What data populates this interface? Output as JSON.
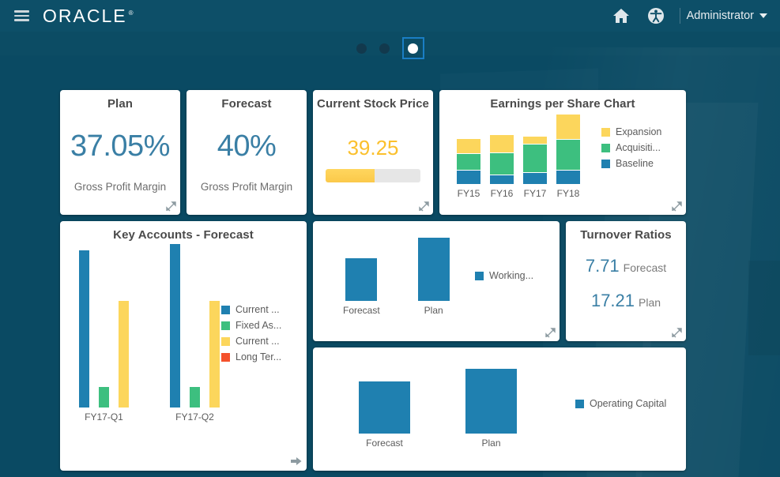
{
  "header": {
    "menu_icon": "hamburger-menu-icon",
    "brand": "ORACLE",
    "brand_tm": "®",
    "home_icon": "home-icon",
    "accessibility_icon": "accessibility-icon",
    "user_label": "Administrator",
    "caret_icon": "chevron-down-icon"
  },
  "pager": {
    "dots": [
      "page-1",
      "page-2",
      "page-3"
    ],
    "selected_index": 2
  },
  "tiles": {
    "plan_kpi": {
      "title": "Plan",
      "value": "37.05%",
      "subtitle": "Gross Profit Margin",
      "resize_icon": "resize-handle-icon"
    },
    "forecast_kpi": {
      "title": "Forecast",
      "value": "40%",
      "subtitle": "Gross Profit Margin",
      "resize_icon": "resize-handle-icon"
    },
    "stock": {
      "title": "Current Stock Price",
      "value": "39.25",
      "progress_percent": 52,
      "fill_color": "#fbc94a",
      "track_color": "#e6e6e6",
      "resize_icon": "resize-handle-icon"
    },
    "eps": {
      "title": "Earnings per Share Chart",
      "resize_icon": "resize-handle-icon"
    },
    "key_accounts": {
      "title": "Key Accounts - Forecast",
      "arrow_icon": "arrow-right-icon"
    },
    "working_capital": {
      "title": "",
      "resize_icon": "resize-handle-icon"
    },
    "turnover": {
      "title": "Turnover Ratios",
      "rows": [
        {
          "value": "7.71",
          "label": "Forecast"
        },
        {
          "value": "17.21",
          "label": "Plan"
        }
      ],
      "resize_icon": "resize-handle-icon"
    },
    "operating_capital": {
      "title": ""
    }
  },
  "chart_data": [
    {
      "id": "eps",
      "type": "bar",
      "stacked": true,
      "title": "Earnings per Share Chart",
      "categories": [
        "FY15",
        "FY16",
        "FY17",
        "FY18"
      ],
      "series": [
        {
          "name": "Baseline",
          "color": "#1f80b0",
          "values": [
            20,
            13,
            17,
            20
          ]
        },
        {
          "name": "Acquisiti...",
          "color": "#3dbf7f",
          "values": [
            26,
            34,
            44,
            48
          ]
        },
        {
          "name": "Expansion",
          "color": "#fcd65c",
          "values": [
            23,
            28,
            12,
            38
          ]
        }
      ],
      "legend_position": "right",
      "xlabel": "",
      "ylabel": "",
      "grid": false
    },
    {
      "id": "key_accounts",
      "type": "bar",
      "stacked": false,
      "title": "Key Accounts - Forecast",
      "categories": [
        "FY17-Q1",
        "FY17-Q2"
      ],
      "series": [
        {
          "name": "Current ...",
          "color": "#1f80b0",
          "values": [
            100,
            104
          ]
        },
        {
          "name": "Fixed As...",
          "color": "#3dbf7f",
          "values": [
            13,
            13
          ]
        },
        {
          "name": "Current ...",
          "color": "#fcd65c",
          "values": [
            68,
            68
          ]
        },
        {
          "name": "Long Ter...",
          "color": "#f4512c",
          "values": [
            0,
            0
          ]
        }
      ],
      "legend_position": "right",
      "xlabel": "",
      "ylabel": "",
      "grid": false
    },
    {
      "id": "working_capital",
      "type": "bar",
      "stacked": false,
      "title": "",
      "categories": [
        "Forecast",
        "Plan"
      ],
      "series": [
        {
          "name": "Working...",
          "color": "#1f80b0",
          "values": [
            68,
            100
          ]
        }
      ],
      "legend_position": "right",
      "xlabel": "",
      "ylabel": "",
      "grid": false
    },
    {
      "id": "operating_capital",
      "type": "bar",
      "stacked": false,
      "title": "",
      "categories": [
        "Forecast",
        "Plan"
      ],
      "series": [
        {
          "name": "Operating Capital",
          "color": "#1f80b0",
          "values": [
            80,
            100
          ]
        }
      ],
      "legend_position": "right",
      "xlabel": "",
      "ylabel": "",
      "grid": false
    }
  ],
  "theme": {
    "background": "#0a4a63",
    "header_bg": "#0d4f68",
    "card_bg": "#ffffff",
    "accent_blue": "#3a7fa5",
    "accent_yellow": "#fbc02d",
    "selected_outline": "#1a7ec4"
  }
}
